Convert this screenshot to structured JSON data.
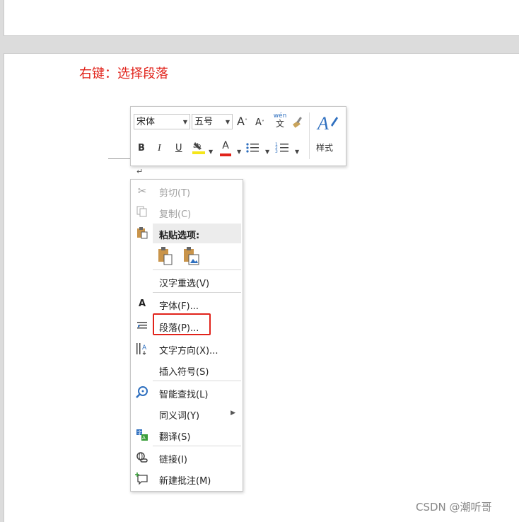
{
  "annotation": "右键：选择段落",
  "para_mark": "↵",
  "mini_toolbar": {
    "font_name": "宋体",
    "font_size": "五号",
    "grow_font": "A",
    "shrink_font": "A",
    "phonetic": "wén",
    "bold": "B",
    "italic": "I",
    "underline": "U",
    "font_color": "A",
    "styles_label": "样式",
    "colors": {
      "highlight": "#f5e61a",
      "font_color": "#e1231b",
      "styles_icon": "#2e6fbf"
    }
  },
  "context_menu": {
    "items": [
      {
        "label": "剪切(T)",
        "icon": "scissors-icon",
        "disabled": true
      },
      {
        "label": "复制(C)",
        "icon": "copy-icon",
        "disabled": true
      },
      {
        "label": "粘贴选项:",
        "icon": "paste-icon"
      },
      {
        "label": "汉字重选(V)"
      },
      {
        "label": "字体(F)...",
        "icon": "font-icon"
      },
      {
        "label": "段落(P)...",
        "icon": "paragraph-icon"
      },
      {
        "label": "文字方向(X)...",
        "icon": "text-direction-icon"
      },
      {
        "label": "插入符号(S)"
      },
      {
        "label": "智能查找(L)",
        "icon": "smart-lookup-icon"
      },
      {
        "label": "同义词(Y)"
      },
      {
        "label": "翻译(S)",
        "icon": "translate-icon"
      },
      {
        "label": "链接(I)",
        "icon": "link-icon"
      },
      {
        "label": "新建批注(M)",
        "icon": "new-comment-icon"
      }
    ]
  },
  "watermark": "CSDN @潮听哥"
}
